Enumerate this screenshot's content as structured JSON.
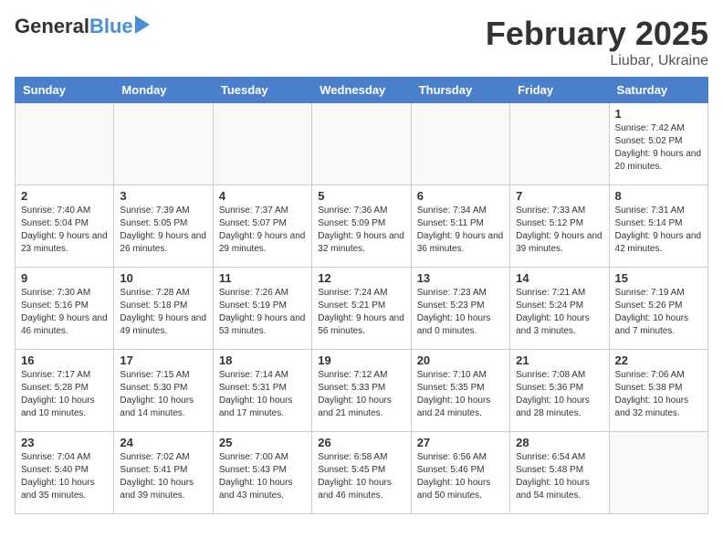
{
  "header": {
    "logo_general": "General",
    "logo_blue": "Blue",
    "title": "February 2025",
    "subtitle": "Liubar, Ukraine"
  },
  "days_of_week": [
    "Sunday",
    "Monday",
    "Tuesday",
    "Wednesday",
    "Thursday",
    "Friday",
    "Saturday"
  ],
  "weeks": [
    [
      {
        "day": "",
        "info": ""
      },
      {
        "day": "",
        "info": ""
      },
      {
        "day": "",
        "info": ""
      },
      {
        "day": "",
        "info": ""
      },
      {
        "day": "",
        "info": ""
      },
      {
        "day": "",
        "info": ""
      },
      {
        "day": "1",
        "info": "Sunrise: 7:42 AM\nSunset: 5:02 PM\nDaylight: 9 hours and 20 minutes."
      }
    ],
    [
      {
        "day": "2",
        "info": "Sunrise: 7:40 AM\nSunset: 5:04 PM\nDaylight: 9 hours and 23 minutes."
      },
      {
        "day": "3",
        "info": "Sunrise: 7:39 AM\nSunset: 5:05 PM\nDaylight: 9 hours and 26 minutes."
      },
      {
        "day": "4",
        "info": "Sunrise: 7:37 AM\nSunset: 5:07 PM\nDaylight: 9 hours and 29 minutes."
      },
      {
        "day": "5",
        "info": "Sunrise: 7:36 AM\nSunset: 5:09 PM\nDaylight: 9 hours and 32 minutes."
      },
      {
        "day": "6",
        "info": "Sunrise: 7:34 AM\nSunset: 5:11 PM\nDaylight: 9 hours and 36 minutes."
      },
      {
        "day": "7",
        "info": "Sunrise: 7:33 AM\nSunset: 5:12 PM\nDaylight: 9 hours and 39 minutes."
      },
      {
        "day": "8",
        "info": "Sunrise: 7:31 AM\nSunset: 5:14 PM\nDaylight: 9 hours and 42 minutes."
      }
    ],
    [
      {
        "day": "9",
        "info": "Sunrise: 7:30 AM\nSunset: 5:16 PM\nDaylight: 9 hours and 46 minutes."
      },
      {
        "day": "10",
        "info": "Sunrise: 7:28 AM\nSunset: 5:18 PM\nDaylight: 9 hours and 49 minutes."
      },
      {
        "day": "11",
        "info": "Sunrise: 7:26 AM\nSunset: 5:19 PM\nDaylight: 9 hours and 53 minutes."
      },
      {
        "day": "12",
        "info": "Sunrise: 7:24 AM\nSunset: 5:21 PM\nDaylight: 9 hours and 56 minutes."
      },
      {
        "day": "13",
        "info": "Sunrise: 7:23 AM\nSunset: 5:23 PM\nDaylight: 10 hours and 0 minutes."
      },
      {
        "day": "14",
        "info": "Sunrise: 7:21 AM\nSunset: 5:24 PM\nDaylight: 10 hours and 3 minutes."
      },
      {
        "day": "15",
        "info": "Sunrise: 7:19 AM\nSunset: 5:26 PM\nDaylight: 10 hours and 7 minutes."
      }
    ],
    [
      {
        "day": "16",
        "info": "Sunrise: 7:17 AM\nSunset: 5:28 PM\nDaylight: 10 hours and 10 minutes."
      },
      {
        "day": "17",
        "info": "Sunrise: 7:15 AM\nSunset: 5:30 PM\nDaylight: 10 hours and 14 minutes."
      },
      {
        "day": "18",
        "info": "Sunrise: 7:14 AM\nSunset: 5:31 PM\nDaylight: 10 hours and 17 minutes."
      },
      {
        "day": "19",
        "info": "Sunrise: 7:12 AM\nSunset: 5:33 PM\nDaylight: 10 hours and 21 minutes."
      },
      {
        "day": "20",
        "info": "Sunrise: 7:10 AM\nSunset: 5:35 PM\nDaylight: 10 hours and 24 minutes."
      },
      {
        "day": "21",
        "info": "Sunrise: 7:08 AM\nSunset: 5:36 PM\nDaylight: 10 hours and 28 minutes."
      },
      {
        "day": "22",
        "info": "Sunrise: 7:06 AM\nSunset: 5:38 PM\nDaylight: 10 hours and 32 minutes."
      }
    ],
    [
      {
        "day": "23",
        "info": "Sunrise: 7:04 AM\nSunset: 5:40 PM\nDaylight: 10 hours and 35 minutes."
      },
      {
        "day": "24",
        "info": "Sunrise: 7:02 AM\nSunset: 5:41 PM\nDaylight: 10 hours and 39 minutes."
      },
      {
        "day": "25",
        "info": "Sunrise: 7:00 AM\nSunset: 5:43 PM\nDaylight: 10 hours and 43 minutes."
      },
      {
        "day": "26",
        "info": "Sunrise: 6:58 AM\nSunset: 5:45 PM\nDaylight: 10 hours and 46 minutes."
      },
      {
        "day": "27",
        "info": "Sunrise: 6:56 AM\nSunset: 5:46 PM\nDaylight: 10 hours and 50 minutes."
      },
      {
        "day": "28",
        "info": "Sunrise: 6:54 AM\nSunset: 5:48 PM\nDaylight: 10 hours and 54 minutes."
      },
      {
        "day": "",
        "info": ""
      }
    ]
  ]
}
